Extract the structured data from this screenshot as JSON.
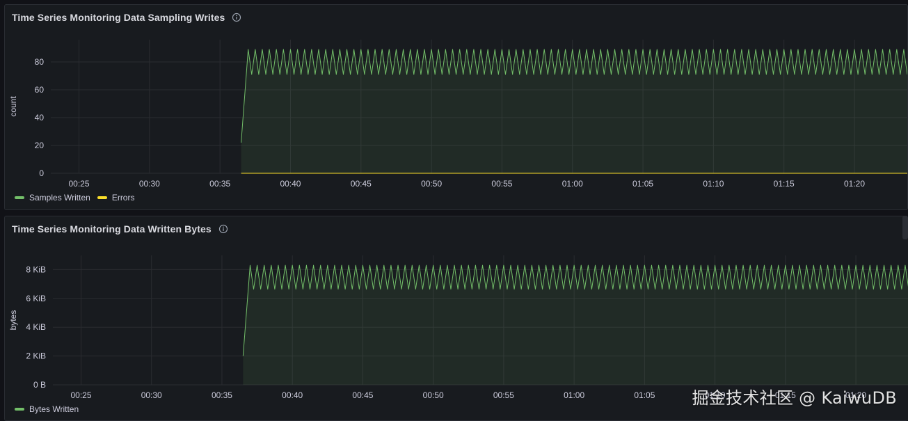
{
  "panels": [
    {
      "title": "Time Series Monitoring Data Sampling Writes",
      "info_icon": "info-circle-icon",
      "chart_data": {
        "type": "line",
        "ylabel": "count",
        "xlabel": "",
        "y_ticks": [
          "0",
          "20",
          "40",
          "60",
          "80"
        ],
        "y_tick_values": [
          0,
          20,
          40,
          60,
          80
        ],
        "ylim": [
          0,
          96
        ],
        "x_ticks": [
          "00:25",
          "00:30",
          "00:35",
          "00:40",
          "00:45",
          "00:50",
          "00:55",
          "01:00",
          "01:05",
          "01:10",
          "01:15",
          "01:20"
        ],
        "xlim": [
          "00:23:00",
          "01:23:45"
        ],
        "grid": true,
        "legend_position": "bottom-left",
        "series": [
          {
            "name": "Samples Written",
            "color": "#73bf69",
            "fill": true,
            "start": "00:36:30",
            "initial_value": 22,
            "pattern": "sawtooth",
            "low": 71,
            "high": 89,
            "period_seconds": 30
          },
          {
            "name": "Errors",
            "color": "#fade2a",
            "fill": false,
            "start": "00:36:30",
            "constant_value": 0
          }
        ]
      }
    },
    {
      "title": "Time Series Monitoring Data Written Bytes",
      "info_icon": "info-circle-icon",
      "chart_data": {
        "type": "line",
        "ylabel": "bytes",
        "xlabel": "",
        "y_ticks": [
          "0 B",
          "2 KiB",
          "4 KiB",
          "6 KiB",
          "8 KiB"
        ],
        "y_tick_values": [
          0,
          2048,
          4096,
          6144,
          8192
        ],
        "ylim": [
          0,
          9200
        ],
        "x_ticks": [
          "00:25",
          "00:30",
          "00:35",
          "00:40",
          "00:45",
          "00:50",
          "00:55",
          "01:00",
          "01:05",
          "01:10",
          "01:15",
          "01:20"
        ],
        "xlim": [
          "00:23:00",
          "01:23:45"
        ],
        "grid": true,
        "legend_position": "bottom-left",
        "series": [
          {
            "name": "Bytes Written",
            "color": "#73bf69",
            "fill": true,
            "start": "00:36:30",
            "initial_value": 2050,
            "pattern": "sawtooth",
            "low": 6800,
            "high": 8500,
            "period_seconds": 30
          }
        ]
      }
    }
  ],
  "watermark": "掘金技术社区 @ KaiwuDB"
}
